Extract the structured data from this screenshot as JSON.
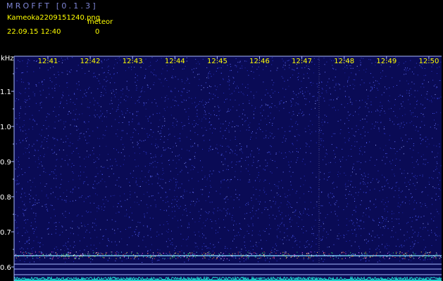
{
  "app": {
    "title": "MROFFT [0.1.3]"
  },
  "file": {
    "name": "Kameoka2209151240.png",
    "timestamp": "22.09.15 12:40"
  },
  "meteor": {
    "label": "meteor",
    "count": "0"
  },
  "spectrogram": {
    "y_unit": "kHz",
    "y_ticks": [
      "1.1",
      "1.0",
      "0.9",
      "0.8",
      "0.7",
      "0.6"
    ],
    "y_values": [
      1.1,
      1.0,
      0.9,
      0.8,
      0.7,
      0.6
    ],
    "time_ticks": [
      "12:41",
      "12:42",
      "12:43",
      "12:44",
      "12:45",
      "12:46",
      "12:47",
      "12:48",
      "12:49",
      "12:50"
    ],
    "colors": {
      "background": "#000000",
      "field": "#0a0b55",
      "axis": "#a8b8ff",
      "tick_labels": "#ffff00",
      "y_labels": "#ffffff",
      "signal_line": "#7fd8ff",
      "noise_floor": "#1fd9d0"
    }
  }
}
